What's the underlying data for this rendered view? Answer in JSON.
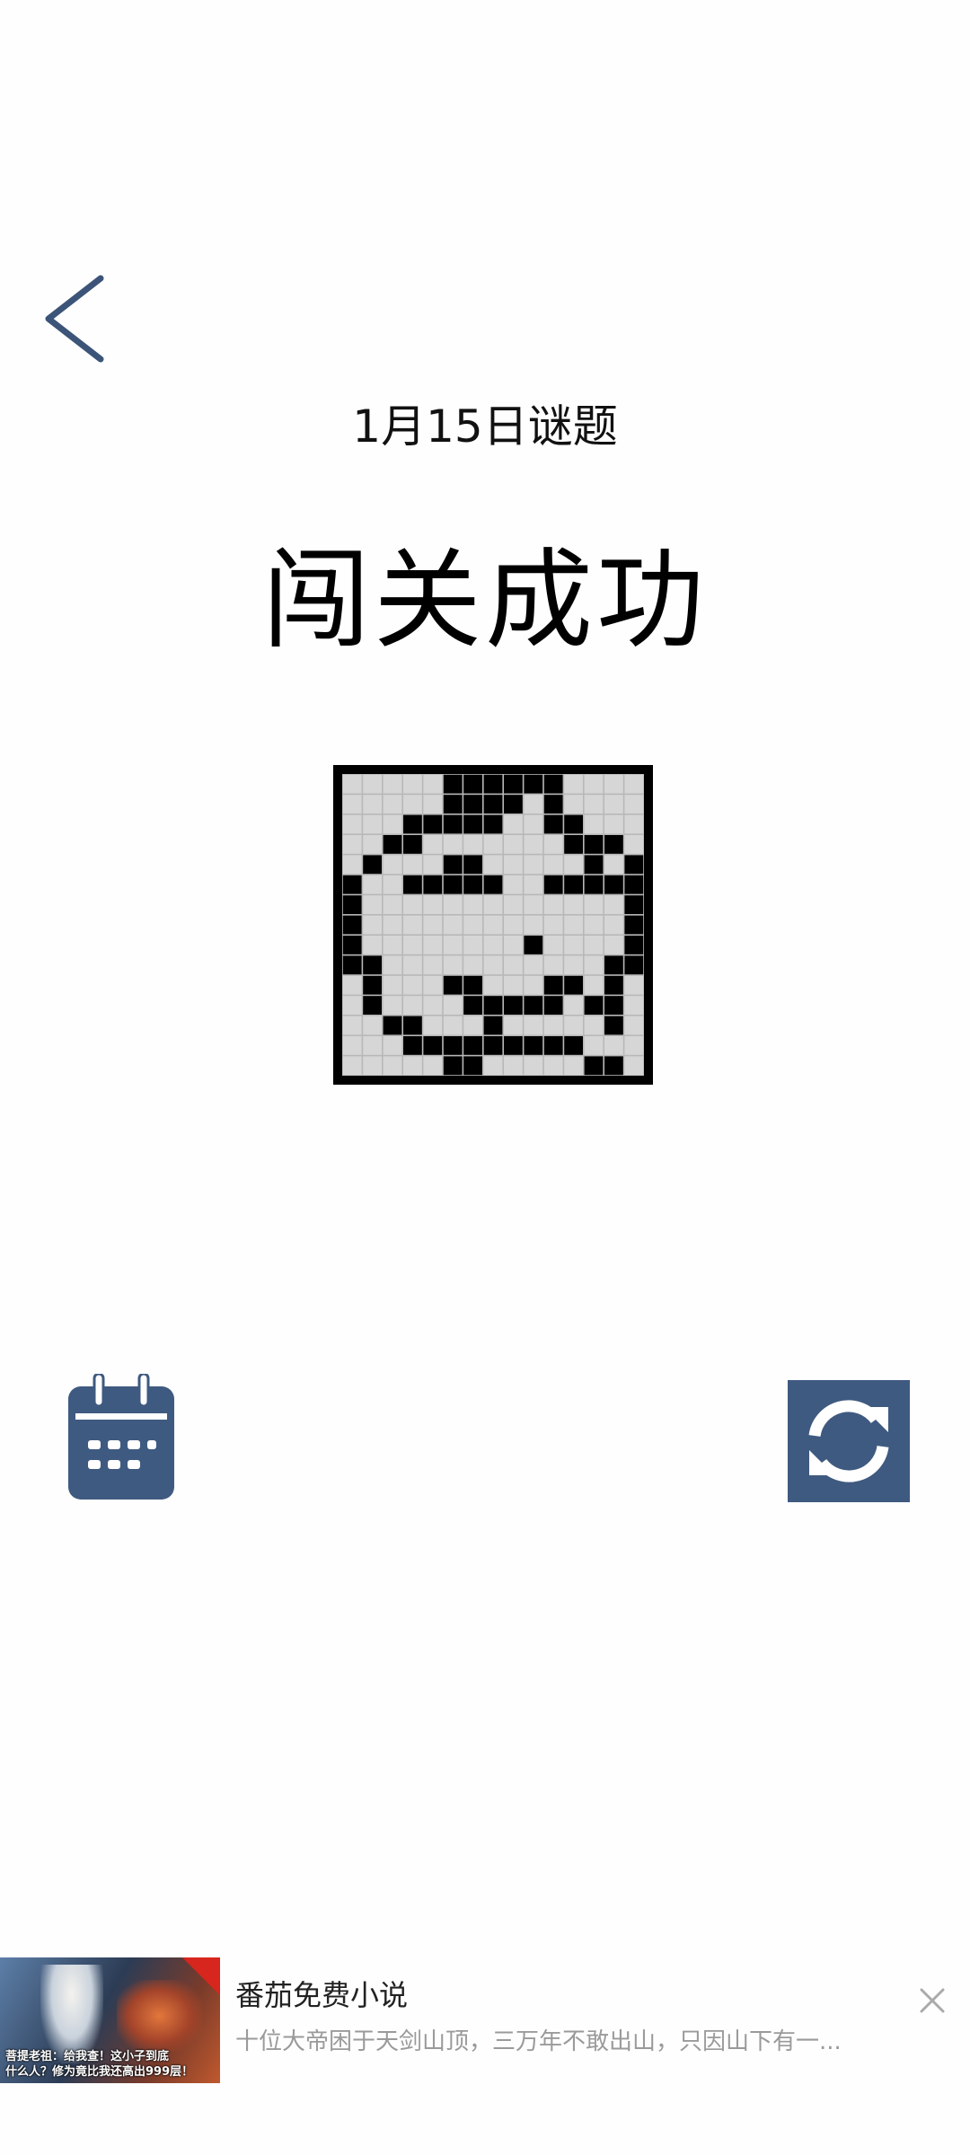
{
  "header": {
    "back_icon": "chevron-left-icon",
    "date_title": "1月15日谜题"
  },
  "result": {
    "status": "闯关成功"
  },
  "nonogram": {
    "size": 15,
    "filled_color": "#000000",
    "empty_color": "#d6d6d6",
    "grid": [
      "000001111110000",
      "000001111010000",
      "000111110011000",
      "001100000001110",
      "010001100000101",
      "100111110011111",
      "100000000000001",
      "100000000000001",
      "100000000100001",
      "110000000000011",
      "010001100011010",
      "010000111110110",
      "001100010000010",
      "000111111111000",
      "000001100000110"
    ]
  },
  "actions": {
    "calendar_icon": "calendar-icon",
    "refresh_icon": "refresh-icon",
    "accent_color": "#3f5a80"
  },
  "ad": {
    "app_name": "番茄免费小说",
    "description": "十位大帝困于天剑山顶，三万年不敢出山，只因山下有一...",
    "thumbnail_caption_line1": "菩提老祖：给我查！这小子到底",
    "thumbnail_caption_line2": "什么人？修为竟比我还高出999层！",
    "close_icon": "close-icon"
  }
}
